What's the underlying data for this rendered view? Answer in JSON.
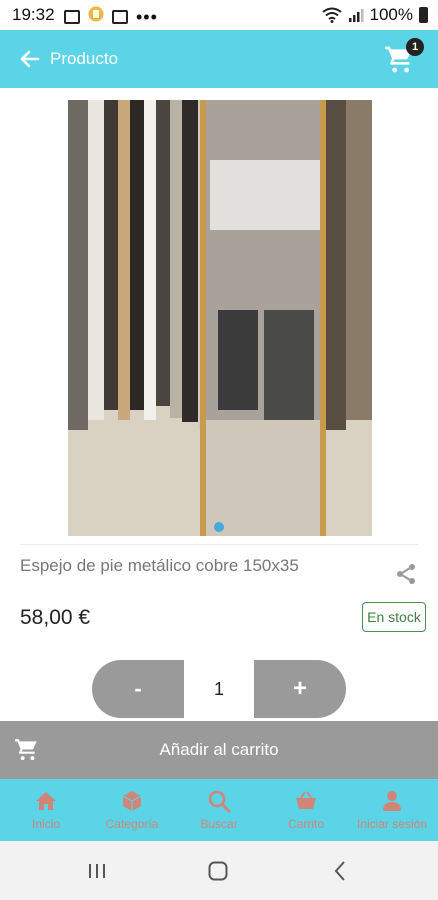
{
  "status_bar": {
    "time": "19:32",
    "battery_pct": "100%"
  },
  "header": {
    "back_label": "Back",
    "title": "Producto",
    "cart_count": "1"
  },
  "product": {
    "name": "Espejo de pie metálico cobre 150x35",
    "price": "58,00 €",
    "stock_status": "En stock",
    "image_page": 1,
    "image_pages": 1
  },
  "quantity": {
    "minus_label": "-",
    "value": "1",
    "plus_label": "+"
  },
  "add_to_cart": {
    "label": "Añadir al carrito"
  },
  "bottom_nav": {
    "items": [
      {
        "label": "Inicio",
        "icon": "home-icon"
      },
      {
        "label": "Categoría",
        "icon": "box-icon"
      },
      {
        "label": "Buscar",
        "icon": "search-icon"
      },
      {
        "label": "Carrito",
        "icon": "basket-icon"
      },
      {
        "label": "Iniciar sesión",
        "icon": "person-icon"
      }
    ]
  },
  "colors": {
    "accent": "#5ad4e6",
    "button_gray": "#9a9a9a",
    "nav_label": "#cf8678",
    "stock_green": "#3f7f42"
  }
}
